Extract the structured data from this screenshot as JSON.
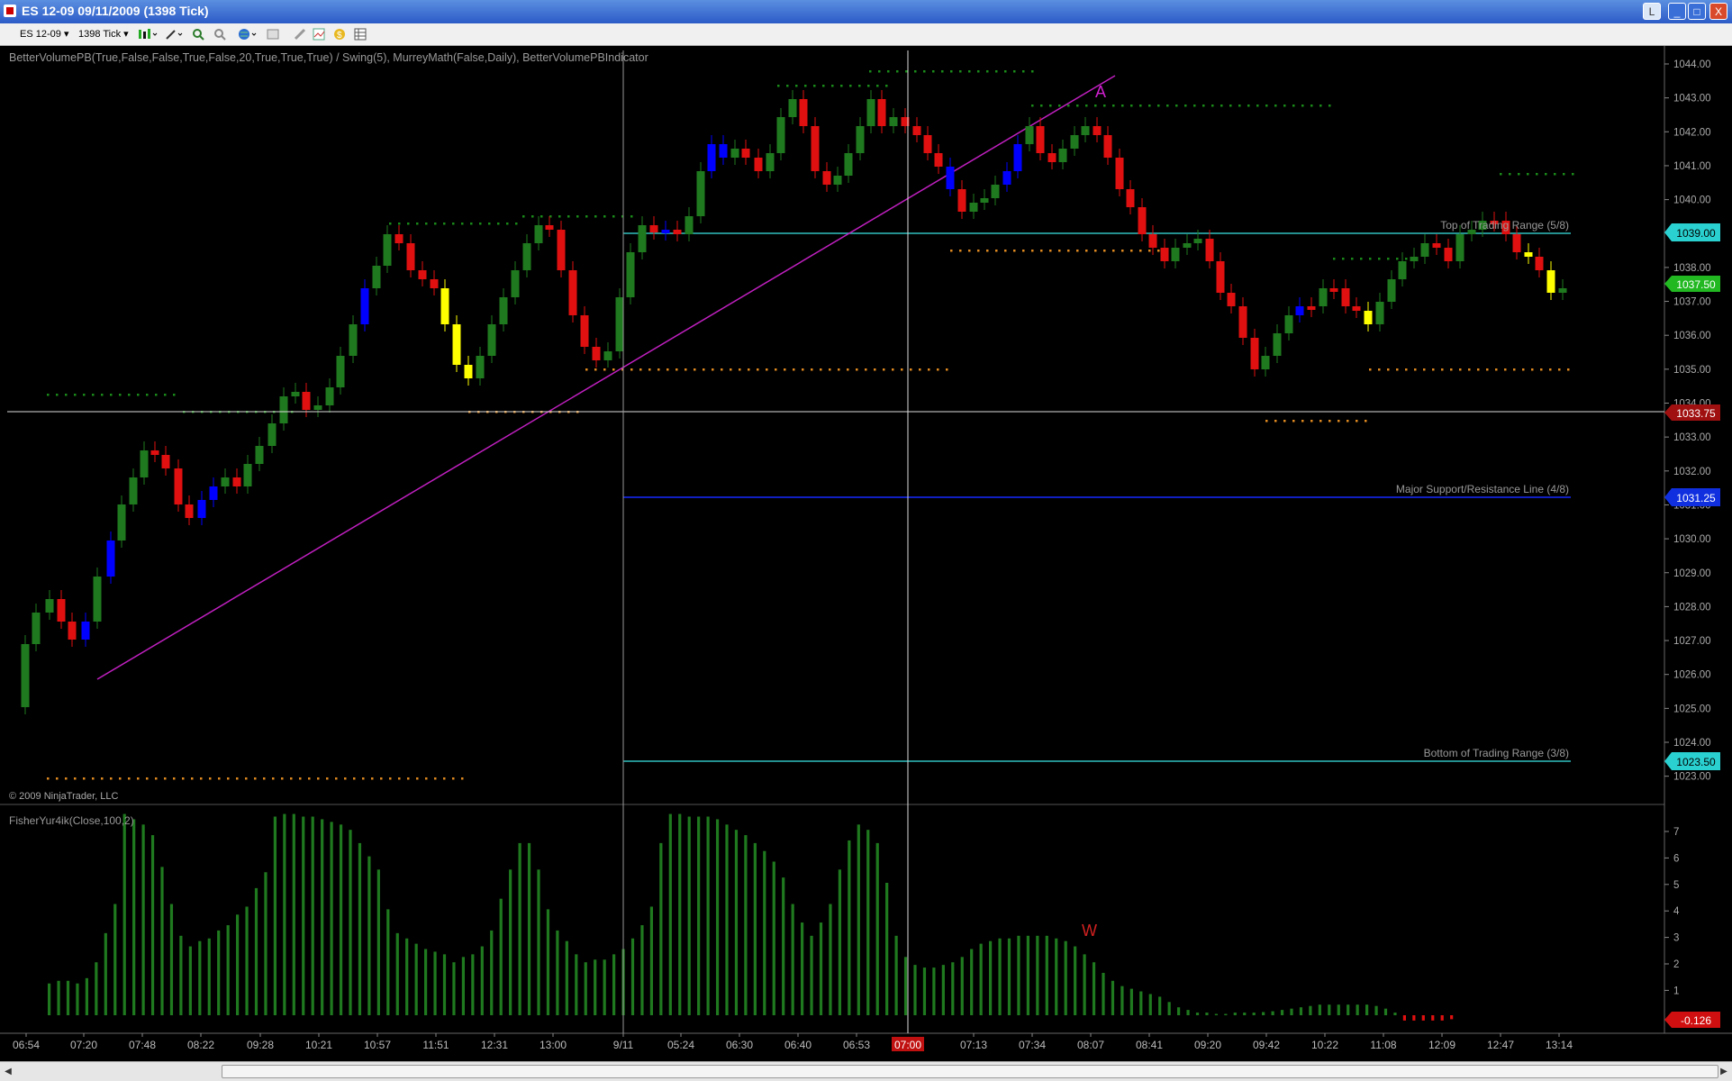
{
  "window": {
    "title": "ES 12-09  09/11/2009 (1398 Tick)",
    "btn_restore_label": "L",
    "btn_min_label": "_",
    "btn_max_label": "□",
    "btn_close_label": "X"
  },
  "toolbar": {
    "instrument": "ES 12-09",
    "period": "1398 Tick",
    "icons": [
      "chart-style-icon",
      "draw-tool-icon",
      "zoom-in-icon",
      "zoom-out-icon",
      "globe-icon",
      "properties-icon",
      "strategy-icon",
      "indicator-icon",
      "currency-icon",
      "data-box-icon"
    ]
  },
  "chart": {
    "indicator_label": "BetterVolumePB(True,False,False,True,False,20,True,True,True)  /  Swing(5),  MurreyMath(False,Daily),  BetterVolumePBIndicator",
    "copyright": "© 2009 NinjaTrader, LLC",
    "lower_label": "FisherYur4ik(Close,100,2)",
    "annotation_A": "A",
    "annotation_W": "W",
    "murrey_top_label": "Top of Trading Range (5/8)",
    "murrey_mid_label": "Major Support/Resistance Line (4/8)",
    "murrey_bottom_label": "Bottom of Trading Range (3/8)",
    "price_ticks": [
      "1044.00",
      "1043.00",
      "1042.00",
      "1041.00",
      "1040.00",
      "1038.00",
      "1037.00",
      "1036.00",
      "1035.00",
      "1034.00",
      "1033.00",
      "1032.00",
      "1031.00",
      "1030.00",
      "1029.00",
      "1028.00",
      "1027.00",
      "1026.00",
      "1025.00",
      "1024.00",
      "1023.00"
    ],
    "fisher_ticks": [
      "7",
      "6",
      "5",
      "4",
      "3",
      "2",
      "1"
    ],
    "time_labels": [
      "06:54",
      "07:20",
      "07:48",
      "08:22",
      "09:28",
      "10:21",
      "10:57",
      "11:51",
      "12:31",
      "13:00",
      "9/11",
      "05:24",
      "06:30",
      "06:40",
      "06:53",
      "07:00",
      "07:13",
      "07:34",
      "08:07",
      "08:41",
      "09:20",
      "09:42",
      "10:22",
      "11:08",
      "12:09",
      "12:47",
      "13:14"
    ],
    "markers": {
      "top": "1039.00",
      "last": "1037.50",
      "crosshair": "1033.75",
      "mid": "1031.25",
      "bottom": "1023.50",
      "fisher_last": "-0.126",
      "crosshair_time": "07:00"
    },
    "colors": {
      "up": "#1f7a1f",
      "down": "#e01010",
      "high_volume": "#0000ff",
      "low_volume": "#ffff00",
      "trendline": "#c020c0",
      "murrey_cyan": "#30c0c0",
      "murrey_blue": "#1020c0",
      "swing_high": "#1a8a1a",
      "swing_low": "#e08a20"
    }
  }
}
